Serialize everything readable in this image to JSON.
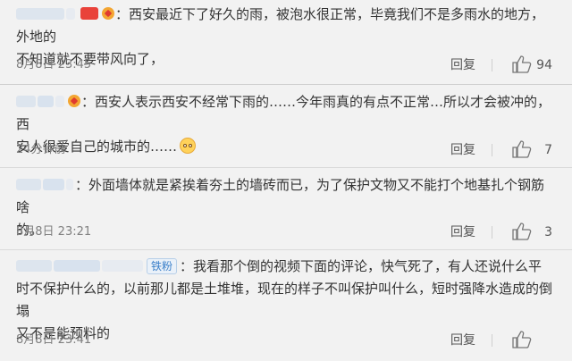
{
  "comments": [
    {
      "username": "",
      "text_line1": "西安最近下了好久的雨，被泡水很正常，毕竟我们不是多雨水的地方，外地的",
      "text_line2": "不知道就不要带风向了，",
      "time": "8月8日 23:45",
      "reply_label": "回复",
      "likes": "94"
    },
    {
      "username": "",
      "text_line1": "西安人表示西安不经常下雨的……今年雨真的有点不正常…所以才会被冲的，西",
      "text_line2": "安人很爱自己的城市的……",
      "emoji": "flushed-face-emoji",
      "time": "24分钟前",
      "reply_label": "回复",
      "likes": "7"
    },
    {
      "username": "",
      "text_line1": "外面墙体就是紧挨着夯土的墙砖而已，为了保护文物又不能打个地基扎个钢筋啥",
      "text_line2": "的。",
      "time": "8月8日 23:21",
      "reply_label": "回复",
      "likes": "3"
    },
    {
      "username": "",
      "fan_badge": "铁粉",
      "text_line1": "我看那个倒的视频下面的评论，快气死了，有人还说什么平",
      "text_line2": "时不保护什么的，以前那儿都是土堆堆，现在的样子不叫保护叫什么，短时强降水造成的倒塌",
      "text_line3": "又不是能预料的",
      "time": "8月8日 23:41",
      "reply_label": "回复",
      "likes": ""
    }
  ],
  "colon": "：",
  "icons": {
    "like": "thumbs-up-icon"
  },
  "colors": {
    "background": "#f2f2f2",
    "text": "#333333",
    "meta": "#808080",
    "fan_badge": "#3a7fc9"
  }
}
